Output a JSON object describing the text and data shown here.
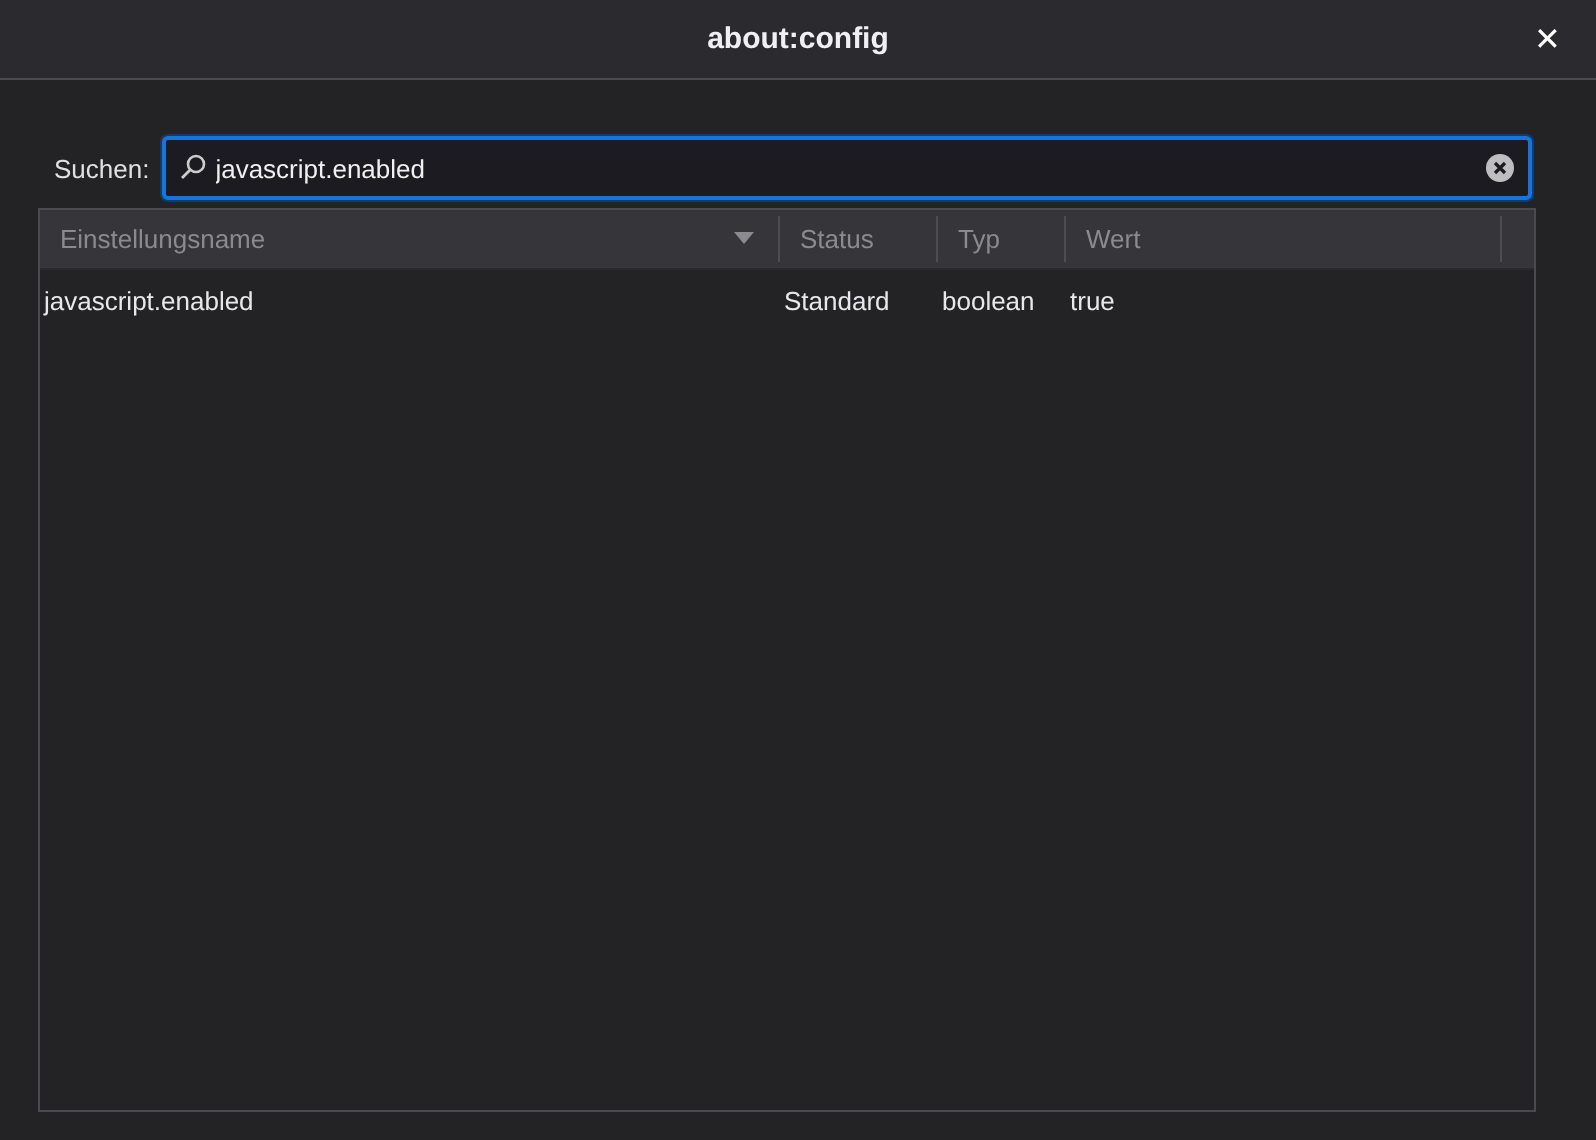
{
  "window": {
    "title": "about:config",
    "close": "✕"
  },
  "search": {
    "label": "Suchen:",
    "value": "javascript.enabled"
  },
  "table": {
    "columns": [
      {
        "label": "Einstellungsname",
        "sorted": true
      },
      {
        "label": "Status",
        "sorted": false
      },
      {
        "label": "Typ",
        "sorted": false
      },
      {
        "label": "Wert",
        "sorted": false
      }
    ],
    "rows": [
      {
        "cells": [
          "javascript.enabled",
          "Standard",
          "boolean",
          "true"
        ],
        "selected": false
      }
    ]
  }
}
